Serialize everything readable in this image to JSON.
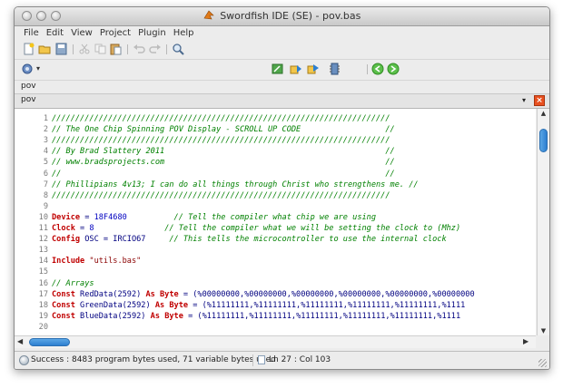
{
  "window": {
    "title": "Swordfish IDE (SE) - pov.bas"
  },
  "menu": [
    "File",
    "Edit",
    "View",
    "Project",
    "Plugin",
    "Help"
  ],
  "toolbar": {
    "file_buttons": [
      "new-file-icon",
      "open-folder-icon",
      "save-icon"
    ],
    "edit_buttons": [
      "cut-icon",
      "copy-icon",
      "paste-icon"
    ],
    "history_buttons": [
      "undo-icon",
      "redo-icon"
    ],
    "find_button": "find-icon",
    "plugin_button": "plugin-icon",
    "build_buttons": [
      "compile-icon",
      "program-icon",
      "build-icon",
      "device-icon"
    ],
    "nav_buttons": [
      "back-icon",
      "forward-icon"
    ]
  },
  "breadcrumb": "pov",
  "tab": {
    "label": "pov",
    "close": "×",
    "dropdown": "▾"
  },
  "colors": {
    "comment": "#008000",
    "keyword": "#c00000",
    "plain": "#000080",
    "number": "#0000c0",
    "string": "#8b0000",
    "accent": "#2d7fd0",
    "close": "#e8501f"
  },
  "editor": {
    "lines": [
      {
        "n": "1",
        "parts": [
          [
            "c",
            "////////////////////////////////////////////////////////////////////////"
          ]
        ]
      },
      {
        "n": "2",
        "parts": [
          [
            "c",
            "// The One Chip Spinning POV Display - SCROLL UP CODE                  //"
          ]
        ]
      },
      {
        "n": "3",
        "parts": [
          [
            "c",
            "////////////////////////////////////////////////////////////////////////"
          ]
        ]
      },
      {
        "n": "4",
        "parts": [
          [
            "c",
            "// By Brad Slattery 2011                                               //"
          ]
        ]
      },
      {
        "n": "5",
        "parts": [
          [
            "c",
            "// www.bradsprojects.com                                               //"
          ]
        ]
      },
      {
        "n": "6",
        "parts": [
          [
            "c",
            "//                                                                     //"
          ]
        ]
      },
      {
        "n": "7",
        "parts": [
          [
            "c",
            "// Phillipians 4v13; I can do all things through Christ who strengthens me. //"
          ]
        ]
      },
      {
        "n": "8",
        "parts": [
          [
            "c",
            "////////////////////////////////////////////////////////////////////////"
          ]
        ]
      },
      {
        "n": "9",
        "parts": []
      },
      {
        "n": "10",
        "parts": [
          [
            "k",
            "Device"
          ],
          [
            "p",
            " = "
          ],
          [
            "n",
            "18F4680"
          ],
          [
            "p",
            "          "
          ],
          [
            "c",
            "// Tell the compiler what chip we are using"
          ]
        ]
      },
      {
        "n": "11",
        "parts": [
          [
            "k",
            "Clock"
          ],
          [
            "p",
            " = "
          ],
          [
            "n",
            "8"
          ],
          [
            "p",
            "               "
          ],
          [
            "c",
            "// Tell the compiler what we will be setting the clock to (Mhz)"
          ]
        ]
      },
      {
        "n": "12",
        "parts": [
          [
            "k",
            "Config"
          ],
          [
            "p",
            " OSC = IRCIO67     "
          ],
          [
            "c",
            "// This tells the microcontroller to use the internal clock"
          ]
        ]
      },
      {
        "n": "13",
        "parts": []
      },
      {
        "n": "14",
        "parts": [
          [
            "k",
            "Include"
          ],
          [
            "p",
            " "
          ],
          [
            "s",
            "\"utils.bas\""
          ]
        ]
      },
      {
        "n": "15",
        "parts": []
      },
      {
        "n": "16",
        "parts": [
          [
            "c",
            "// Arrays"
          ]
        ]
      },
      {
        "n": "17",
        "parts": [
          [
            "k",
            "Const"
          ],
          [
            "p",
            " RedData(2592) "
          ],
          [
            "k",
            "As Byte"
          ],
          [
            "p",
            " = (%00000000,%00000000,%00000000,%00000000,%00000000,%00000000"
          ]
        ]
      },
      {
        "n": "18",
        "parts": [
          [
            "k",
            "Const"
          ],
          [
            "p",
            " GreenData(2592) "
          ],
          [
            "k",
            "As Byte"
          ],
          [
            "p",
            " = (%11111111,%11111111,%11111111,%11111111,%11111111,%1111"
          ]
        ]
      },
      {
        "n": "19",
        "parts": [
          [
            "k",
            "Const"
          ],
          [
            "p",
            " BlueData(2592) "
          ],
          [
            "k",
            "As Byte"
          ],
          [
            "p",
            " = (%11111111,%11111111,%11111111,%11111111,%11111111,%1111"
          ]
        ]
      },
      {
        "n": "20",
        "parts": []
      }
    ]
  },
  "status": {
    "message": "Success : 8483 program bytes used, 71 variable bytes used",
    "position": "Ln 27 : Col 103"
  }
}
